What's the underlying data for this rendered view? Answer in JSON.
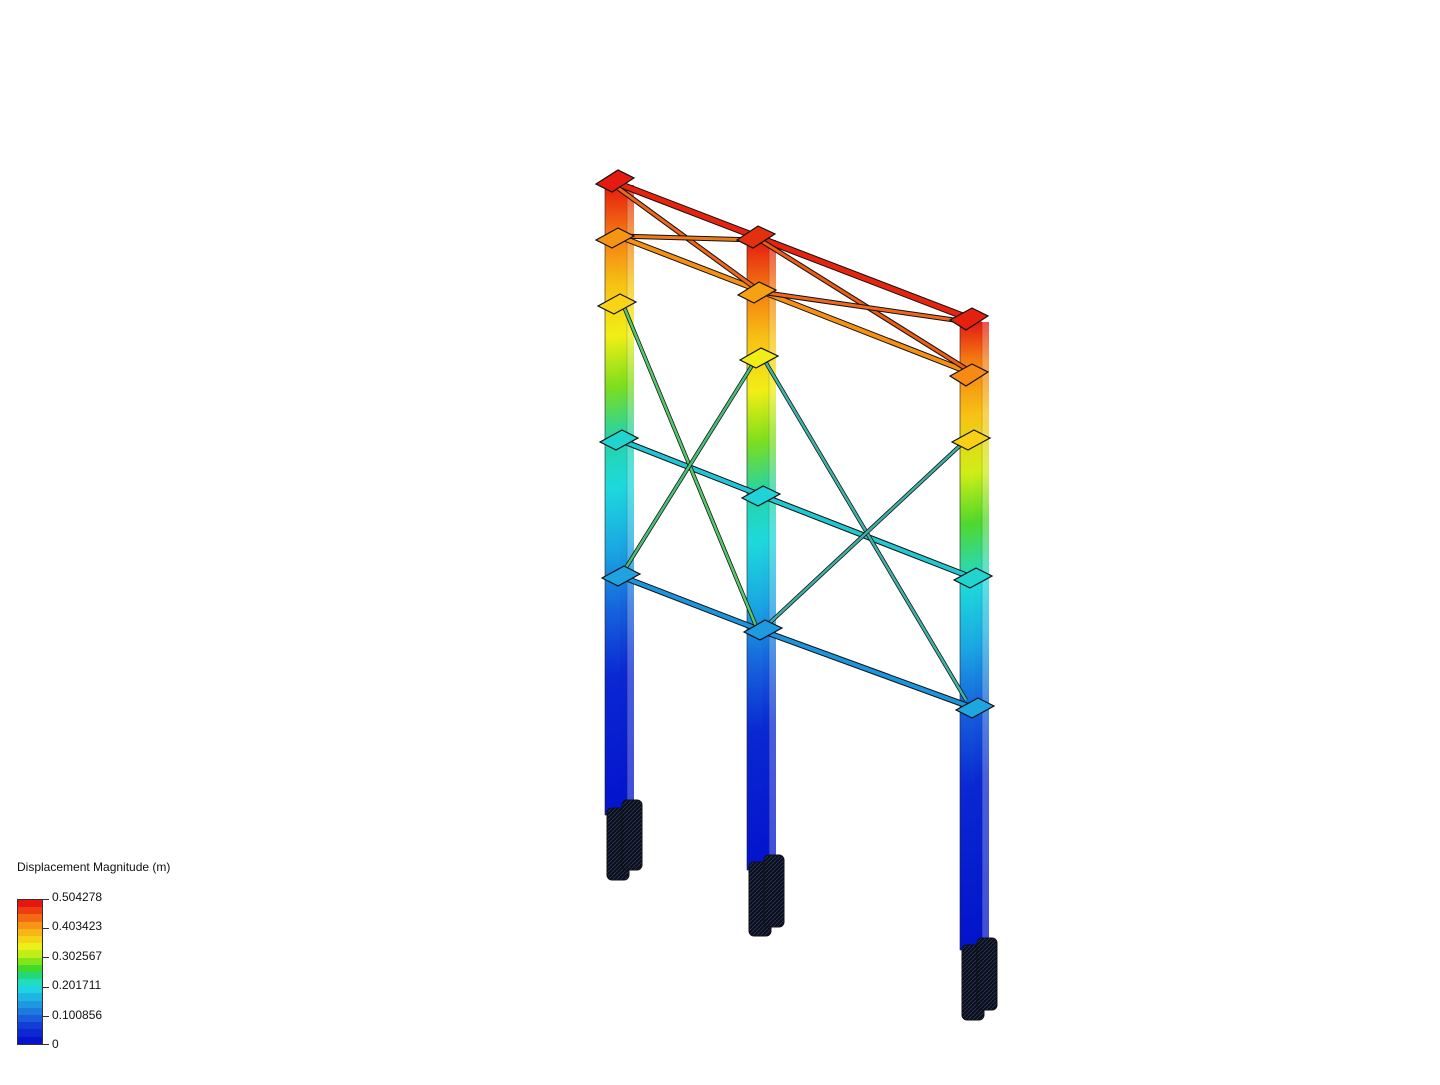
{
  "legend": {
    "title": "Displacement Magnitude (m)",
    "ticks": [
      "0.504278",
      "0.403423",
      "0.302567",
      "0.201711",
      "0.100856",
      "0"
    ],
    "colors": [
      "#e6150f",
      "#ee3d10",
      "#f46a12",
      "#f79414",
      "#f8b616",
      "#f4d516",
      "#eaf018",
      "#c2ee17",
      "#82e51a",
      "#3fda2a",
      "#24d676",
      "#20dcc0",
      "#20d3e3",
      "#1eb6e3",
      "#1f98e1",
      "#1d7be0",
      "#1a5cdc",
      "#123ed6",
      "#0b28d2",
      "#0514cc"
    ]
  },
  "viewport": {
    "label": "3D displacement result view of braced frame structure"
  }
}
